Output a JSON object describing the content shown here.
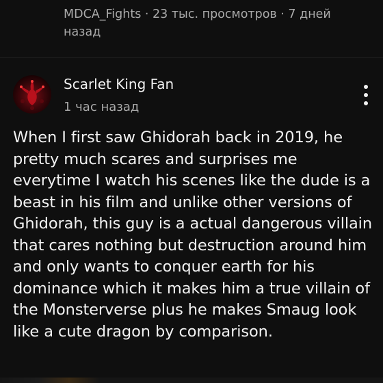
{
  "video": {
    "meta": "MDCA_Fights · 23 тыс. просмотров · 7 дней назад"
  },
  "comment": {
    "author": "Scarlet King Fan",
    "timestamp": "1 час назад",
    "text": "When I first saw Ghidorah back in 2019, he pretty much scares and surprises me everytime I watch his scenes like the dude is a beast in his film and unlike other versions of Ghidorah, this guy is a actual dangerous villain that cares nothing but destruction around him and only wants to conquer earth for his dominance which it makes him a true villain of the Monsterverse plus he makes Smaug look like a cute dragon by comparison.",
    "avatar_icon": "dragon-avatar-icon",
    "more_icon": "more-vertical-icon"
  },
  "colors": {
    "background": "#0f0f0f",
    "primary_text": "#f1f1f1",
    "secondary_text": "#aaaaaa",
    "avatar_accent": "#b3121f"
  }
}
